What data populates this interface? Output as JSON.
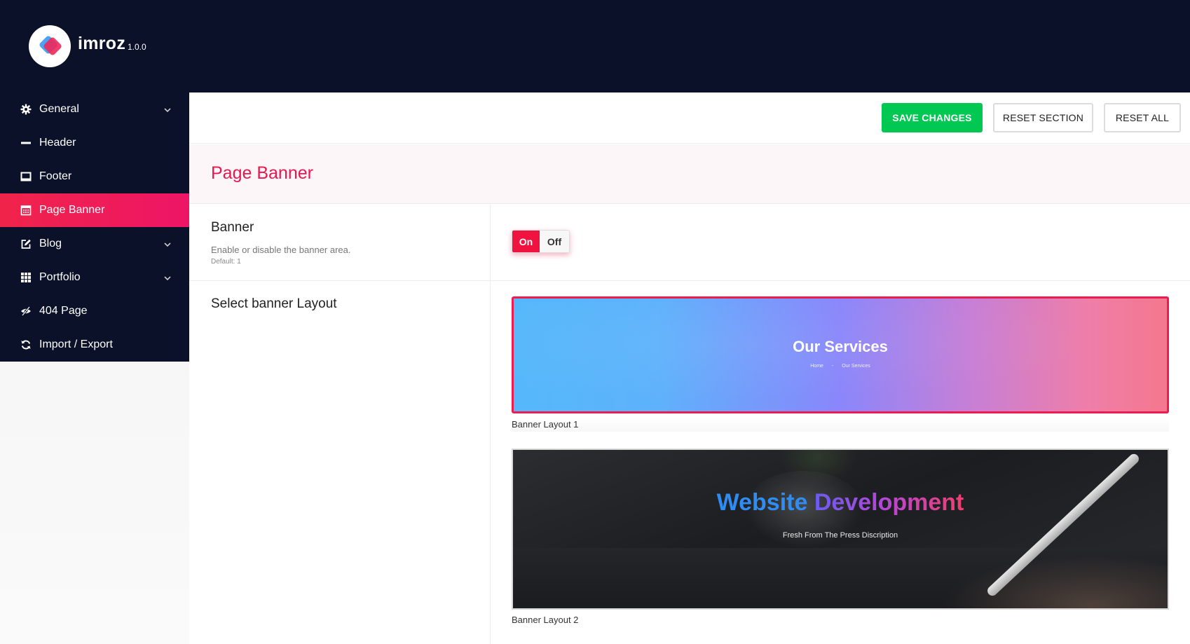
{
  "app": {
    "name": "imroz",
    "version": "1.0.0"
  },
  "sidebar": {
    "items": [
      {
        "label": "General",
        "icon": "gear-icon",
        "has_submenu": true
      },
      {
        "label": "Header",
        "icon": "minus-icon",
        "has_submenu": false
      },
      {
        "label": "Footer",
        "icon": "monitor-icon",
        "has_submenu": false
      },
      {
        "label": "Page Banner",
        "icon": "calendar-icon",
        "has_submenu": false,
        "active": true
      },
      {
        "label": "Blog",
        "icon": "edit-icon",
        "has_submenu": true
      },
      {
        "label": "Portfolio",
        "icon": "grid-icon",
        "has_submenu": true
      },
      {
        "label": "404 Page",
        "icon": "eye-slash-icon",
        "has_submenu": false
      },
      {
        "label": "Import / Export",
        "icon": "refresh-icon",
        "has_submenu": false
      }
    ]
  },
  "toolbar": {
    "save_label": "SAVE CHANGES",
    "reset_section_label": "RESET SECTION",
    "reset_all_label": "RESET ALL"
  },
  "section": {
    "title": "Page Banner"
  },
  "fields": {
    "banner": {
      "title": "Banner",
      "description": "Enable or disable the banner area.",
      "default_text": "Default: 1",
      "on_label": "On",
      "off_label": "Off",
      "value": "On"
    },
    "layout": {
      "title": "Select banner Layout",
      "selected": "Banner Layout 1",
      "options": [
        {
          "caption": "Banner Layout 1",
          "preview_title": "Our Services",
          "preview_crumb_home": "Home",
          "preview_crumb_current": "Our Services"
        },
        {
          "caption": "Banner Layout 2",
          "preview_title_part1": "Website",
          "preview_title_part2": "Development",
          "preview_subtitle": "Fresh From The Press Discription"
        }
      ]
    }
  },
  "colors": {
    "sidebar_bg": "#0a1128",
    "accent": "#e8174f",
    "save_button": "#00c853"
  }
}
